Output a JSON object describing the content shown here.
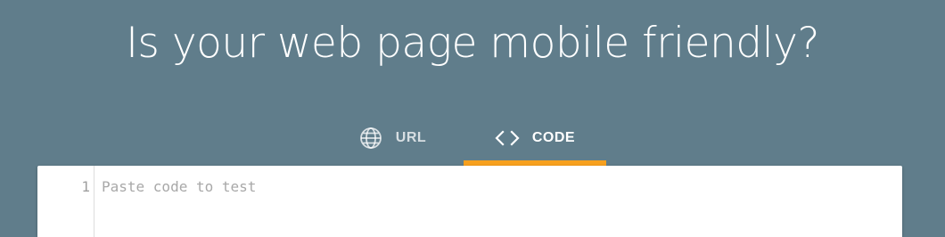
{
  "header": {
    "title": "Is your web page mobile friendly?"
  },
  "tabs": [
    {
      "label": "URL",
      "icon": "globe-icon",
      "active": false
    },
    {
      "label": "CODE",
      "icon": "code-brackets-icon",
      "active": true
    }
  ],
  "editor": {
    "line_number": "1",
    "placeholder": "Paste code to test",
    "value": ""
  },
  "colors": {
    "background": "#607d8b",
    "active_tab_indicator": "#f7a01e",
    "title_text": "#ffffff",
    "editor_background": "#ffffff"
  }
}
